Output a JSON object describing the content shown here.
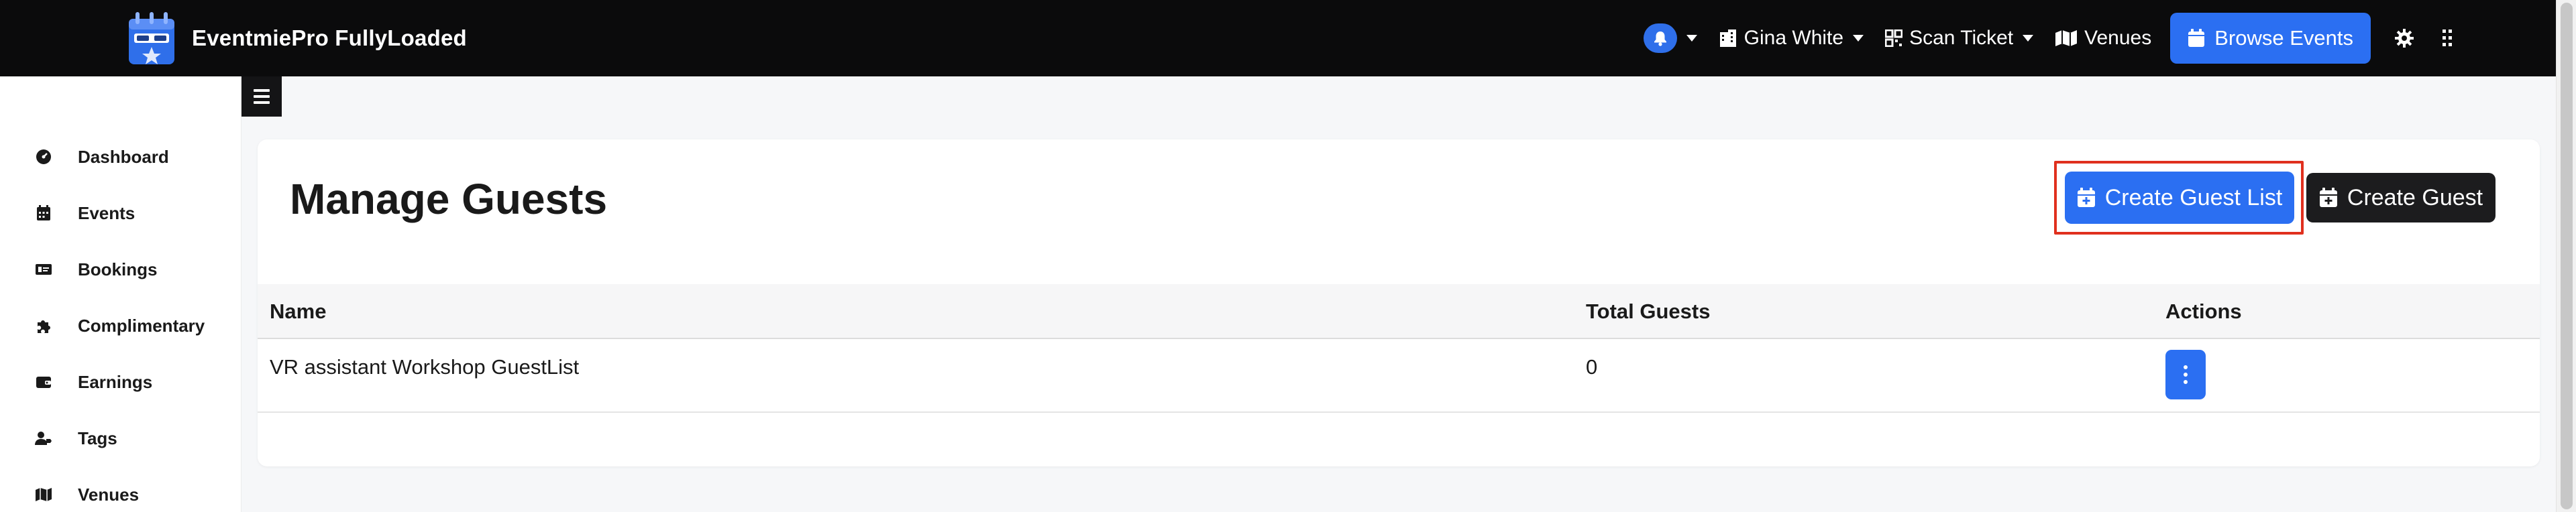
{
  "brand": {
    "name": "EventmiePro FullyLoaded"
  },
  "navbar": {
    "user_name": "Gina White",
    "scan_ticket": "Scan Ticket",
    "venues": "Venues",
    "browse_events": "Browse Events"
  },
  "sidebar": {
    "items": [
      {
        "label": "Dashboard",
        "icon": "dashboard-gauge-icon"
      },
      {
        "label": "Events",
        "icon": "calendar-icon"
      },
      {
        "label": "Bookings",
        "icon": "ticket-icon"
      },
      {
        "label": "Complimentary",
        "icon": "puzzle-icon"
      },
      {
        "label": "Earnings",
        "icon": "wallet-icon"
      },
      {
        "label": "Tags",
        "icon": "user-tag-icon"
      },
      {
        "label": "Venues",
        "icon": "map-icon"
      }
    ]
  },
  "page": {
    "title": "Manage Guests",
    "create_guest_list": "Create Guest List",
    "create_guest": "Create Guest"
  },
  "table": {
    "columns": [
      "Name",
      "Total Guests",
      "Actions"
    ],
    "rows": [
      {
        "name": "VR assistant Workshop GuestList",
        "total_guests": "0"
      }
    ]
  },
  "colors": {
    "navbar_bg": "#0b0b0c",
    "primary": "#2b6ff2",
    "dark_button": "#1c1c1e",
    "highlight": "#e0301e"
  }
}
